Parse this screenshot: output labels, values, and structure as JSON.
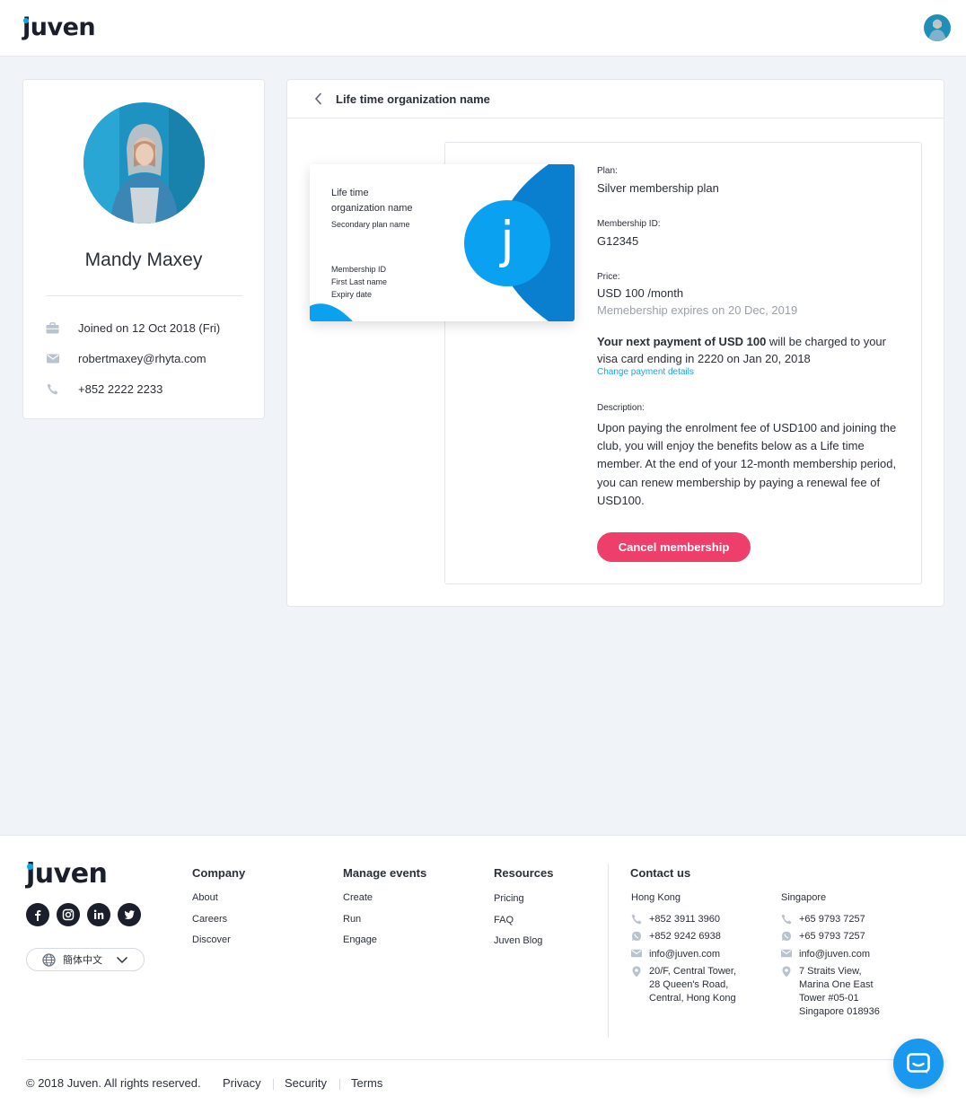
{
  "app": {
    "logo": "juven"
  },
  "user": {
    "name": "Mandy Maxey",
    "joined": "Joined on 12 Oct 2018 (Fri)",
    "email": "robertmaxey@rhyta.com",
    "phone": "+852 2222 2233"
  },
  "main": {
    "title": "Life time organization name",
    "card": {
      "org_line1": "Life time",
      "org_line2": "organization name",
      "secondary": "Secondary plan name",
      "membership_id_label": "Membership ID",
      "name_label": "First Last name",
      "expiry_label": "Expiry date",
      "badge_letter": "j"
    },
    "plan_label": "Plan:",
    "plan_value": "Silver membership plan",
    "membership_id_label": "Membership ID:",
    "membership_id_value": "G12345",
    "price_label": "Price:",
    "price_value": "USD 100 /month",
    "expires": "Memebership expires on 20 Dec, 2019",
    "next_payment_bold": "Your next payment of USD 100",
    "next_payment_rest1": " will be charged to your",
    "next_payment_line2": "visa card ending in 2220 on Jan 20, 2018",
    "change_payment": "Change payment details",
    "description_label": "Description:",
    "description": "Upon paying the enrolment fee of USD100 and joining the club, you will enjoy the benefits below as a Life time member. At the end of your 12-month membership period, you can renew membership by paying a renewal fee of USD100.",
    "cancel_button": "Cancel membership"
  },
  "footer": {
    "logo": "juven",
    "language": "簡体中文",
    "company": {
      "heading": "Company",
      "items": [
        "About",
        "Careers",
        "Discover"
      ]
    },
    "manage": {
      "heading": "Manage events",
      "items": [
        "Create",
        "Run",
        "Engage"
      ]
    },
    "resources": {
      "heading": "Resources",
      "items": [
        "Pricing",
        "FAQ",
        "Juven Blog"
      ]
    },
    "contact": {
      "heading": "Contact us",
      "hk": {
        "city": "Hong Kong",
        "phone": "+852 3911 3960",
        "whatsapp": "+852 9242 6938",
        "email": "info@juven.com",
        "address": [
          "20/F, Central Tower,",
          "28 Queen's Road,",
          "Central, Hong Kong"
        ]
      },
      "sg": {
        "city": "Singapore",
        "phone": "+65 9793 7257",
        "whatsapp": "+65 9793 7257",
        "email": "info@juven.com",
        "address": [
          "7 Straits View,",
          "Marina One East",
          "Tower #05-01",
          "Singapore 018936"
        ]
      }
    },
    "copyright": "© 2018 Juven. All rights reserved.",
    "links": [
      "Privacy",
      "Security",
      "Terms"
    ]
  },
  "colors": {
    "accent": "#0aa7ee",
    "brand_dark": "#1a1f2b",
    "cancel": "#ee3f6b",
    "link": "#1ea0e6"
  },
  "icons": [
    "briefcase-icon",
    "envelope-icon",
    "phone-icon",
    "back-chevron-icon",
    "facebook-icon",
    "instagram-icon",
    "linkedin-icon",
    "twitter-icon",
    "globe-icon",
    "chevron-down-icon",
    "whatsapp-icon",
    "map-pin-icon",
    "chat-icon"
  ]
}
